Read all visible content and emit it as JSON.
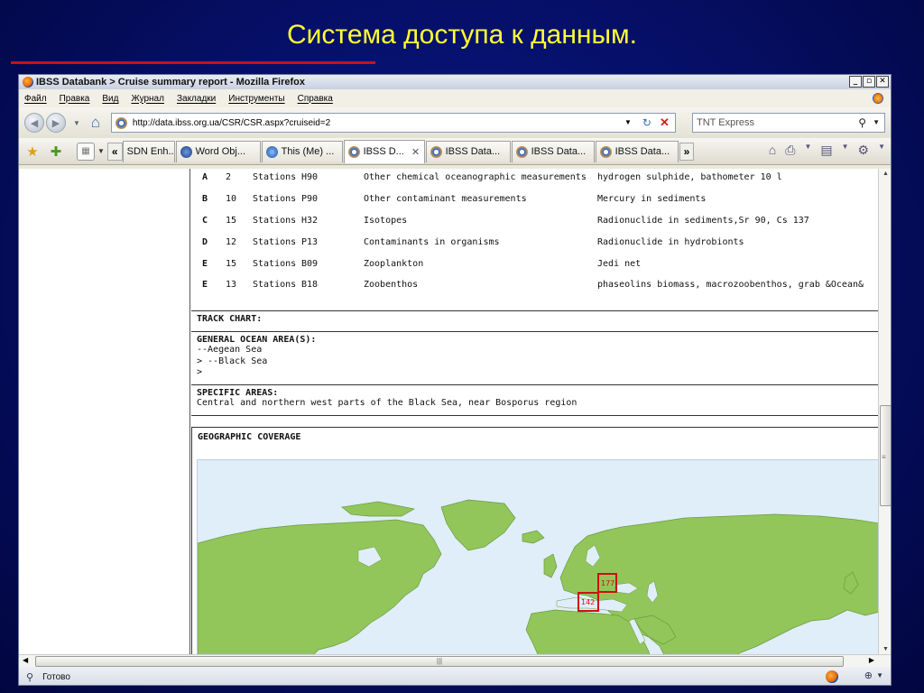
{
  "slide": {
    "title": "Система доступа к данным."
  },
  "window": {
    "title": "IBSS Databank > Cruise summary report - Mozilla Firefox",
    "buttons": [
      "_",
      "▫",
      "✕"
    ]
  },
  "menu": [
    "Файл",
    "Правка",
    "Вид",
    "Журнал",
    "Закладки",
    "Инструменты",
    "Справка"
  ],
  "nav": {
    "url": "http://data.ibss.org.ua/CSR/CSR.aspx?cruiseid=2",
    "search_value": "TNT Express"
  },
  "tabs": [
    {
      "label": "SDN Enh...",
      "icon": "none",
      "active": false
    },
    {
      "label": "Word Obj...",
      "icon": "word",
      "active": false
    },
    {
      "label": "This (Me) ...",
      "icon": "ppt",
      "active": false
    },
    {
      "label": "IBSS D...",
      "icon": "ie",
      "active": true
    },
    {
      "label": "IBSS Data...",
      "icon": "ie",
      "active": false
    },
    {
      "label": "IBSS Data...",
      "icon": "ie",
      "active": false
    },
    {
      "label": "IBSS Data...",
      "icon": "ie",
      "active": false
    }
  ],
  "tab_overflow": "»",
  "tab_scroll_left": "«",
  "rows": [
    {
      "code": "A",
      "num": "2",
      "unit": "Stations",
      "pcode": "H90",
      "desc": "Other chemical oceanographic measurements",
      "param": "hydrogen sulphide, bathometer 10 l"
    },
    {
      "code": "B",
      "num": "10",
      "unit": "Stations",
      "pcode": "P90",
      "desc": "Other contaminant measurements",
      "param": "Mercury in sediments"
    },
    {
      "code": "C",
      "num": "15",
      "unit": "Stations",
      "pcode": "H32",
      "desc": "Isotopes",
      "param": "Radionuclide in sediments,Sr 90, Cs 137"
    },
    {
      "code": "D",
      "num": "12",
      "unit": "Stations",
      "pcode": "P13",
      "desc": "Contaminants in organisms",
      "param": "Radionuclide in hydrobionts"
    },
    {
      "code": "E",
      "num": "15",
      "unit": "Stations",
      "pcode": "B09",
      "desc": "Zooplankton",
      "param": "Jedi net"
    },
    {
      "code": "E",
      "num": "13",
      "unit": "Stations",
      "pcode": "B18",
      "desc": "Zoobenthos",
      "param": "phaseolins biomass, macrozoobenthos, grab &Ocean&"
    }
  ],
  "sections": {
    "track_chart": "TRACK CHART:",
    "ocean_area_head": "GENERAL OCEAN AREA(S):",
    "ocean_area_lines": [
      "--Aegean Sea",
      "> --Black Sea",
      ">"
    ],
    "specific_head": "SPECIFIC AREAS:",
    "specific_body": "Central and northern west parts of the Black Sea, near Bosporus region",
    "geo_head": "GEOGRAPHIC COVERAGE"
  },
  "map": {
    "markers": [
      "177",
      "142"
    ],
    "land_color": "#92c65a",
    "water_color": "#dfeef8",
    "marker_color": "#cc1111"
  },
  "status": {
    "text": "Готово"
  }
}
